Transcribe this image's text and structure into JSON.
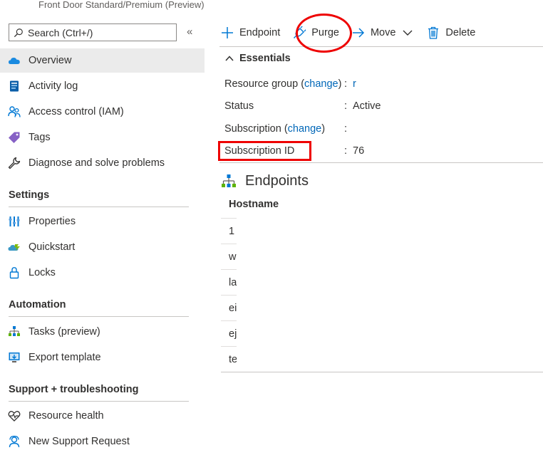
{
  "header": {
    "subtitle": "Front Door Standard/Premium (Preview)"
  },
  "search": {
    "placeholder": "Search (Ctrl+/)",
    "collapse_glyph": "«"
  },
  "nav": {
    "top_items": [
      {
        "label": "Overview",
        "icon": "cloud-icon"
      },
      {
        "label": "Activity log",
        "icon": "activity-log-icon"
      },
      {
        "label": "Access control (IAM)",
        "icon": "people-icon"
      },
      {
        "label": "Tags",
        "icon": "tag-icon"
      },
      {
        "label": "Diagnose and solve problems",
        "icon": "wrench-icon"
      }
    ],
    "sections": [
      {
        "title": "Settings",
        "items": [
          {
            "label": "Properties",
            "icon": "properties-icon"
          },
          {
            "label": "Quickstart",
            "icon": "quickstart-icon"
          },
          {
            "label": "Locks",
            "icon": "lock-icon"
          }
        ]
      },
      {
        "title": "Automation",
        "items": [
          {
            "label": "Tasks (preview)",
            "icon": "tasks-icon"
          },
          {
            "label": "Export template",
            "icon": "export-template-icon"
          }
        ]
      },
      {
        "title": "Support + troubleshooting",
        "items": [
          {
            "label": "Resource health",
            "icon": "heart-pulse-icon"
          },
          {
            "label": "New Support Request",
            "icon": "support-person-icon"
          }
        ]
      }
    ]
  },
  "toolbar": {
    "endpoint": "Endpoint",
    "purge": "Purge",
    "move": "Move",
    "delete": "Delete"
  },
  "essentials": {
    "heading": "Essentials",
    "resource_group_label": "Resource group",
    "change_link": "change",
    "status_label": "Status",
    "status_value": "Active",
    "subscription_label": "Subscription",
    "subscription_id_label": "Subscription ID",
    "resource_group_value": "r",
    "subscription_id_value": "76"
  },
  "endpoints": {
    "title": "Endpoints",
    "column": "Hostname",
    "rows": [
      "1",
      "w",
      "la",
      "ei",
      "ej",
      "te"
    ]
  },
  "colors": {
    "accent": "#0067b8",
    "annotation": "#e00000",
    "selected_bg": "#ebebeb"
  }
}
